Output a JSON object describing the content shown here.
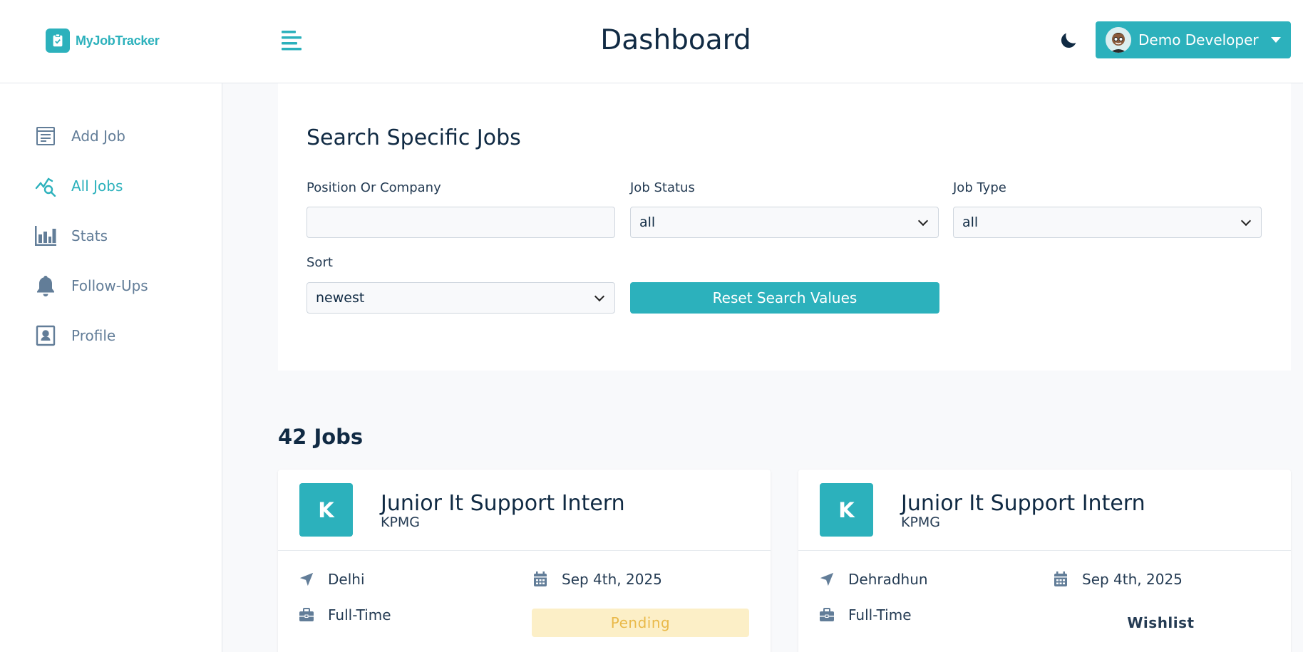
{
  "app": {
    "name": "MyJobTracker",
    "page_title": "Dashboard",
    "user_name": "Demo Developer"
  },
  "colors": {
    "accent": "#2cb1bc",
    "pending_bg": "#fcefc7",
    "pending_text": "#e9b949"
  },
  "icons": {
    "logo": "clipboard-check-icon",
    "menu": "menu-toggle-icon",
    "theme": "moon-icon",
    "user_menu": "caret-down-icon"
  },
  "sidebar": {
    "items": [
      {
        "label": "Add Job",
        "icon": "form-icon",
        "active": false
      },
      {
        "label": "All Jobs",
        "icon": "query-stats-icon",
        "active": true
      },
      {
        "label": "Stats",
        "icon": "bar-chart-icon",
        "active": false
      },
      {
        "label": "Follow-Ups",
        "icon": "bell-icon",
        "active": false
      },
      {
        "label": "Profile",
        "icon": "id-card-icon",
        "active": false
      }
    ]
  },
  "search": {
    "title": "Search Specific Jobs",
    "position_label": "Position Or Company",
    "position_value": "",
    "status_label": "Job Status",
    "status_value": "all",
    "type_label": "Job Type",
    "type_value": "all",
    "sort_label": "Sort",
    "sort_value": "newest",
    "reset_label": "Reset Search Values"
  },
  "jobs": {
    "count_label": "42 Jobs",
    "cards": [
      {
        "initial": "K",
        "title": "Junior It Support Intern",
        "company": "KPMG",
        "location": "Delhi",
        "date": "Sep 4th, 2025",
        "type": "Full-Time",
        "status": "Pending"
      },
      {
        "initial": "K",
        "title": "Junior It Support Intern",
        "company": "KPMG",
        "location": "Dehradhun",
        "date": "Sep 4th, 2025",
        "type": "Full-Time",
        "status": "Wishlist"
      }
    ]
  }
}
